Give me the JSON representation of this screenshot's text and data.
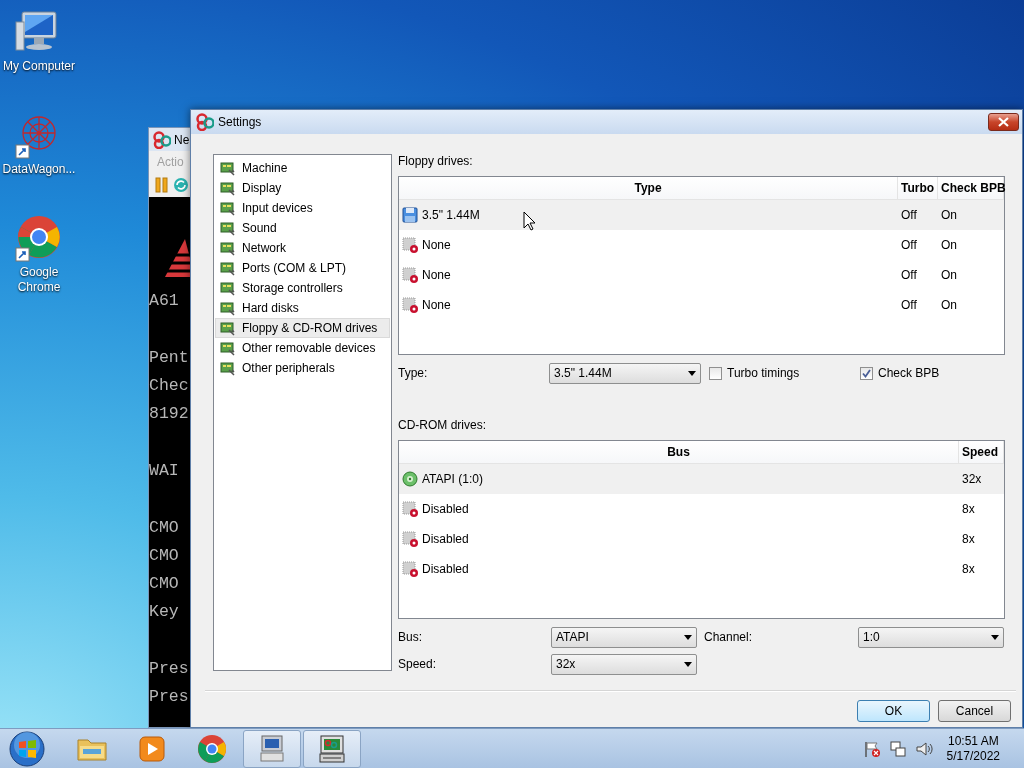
{
  "desktop_icons": [
    {
      "label": "My Computer",
      "kind": "computer"
    },
    {
      "label": "DataWagon...",
      "kind": "network"
    },
    {
      "label": "Google Chrome",
      "kind": "browser"
    }
  ],
  "background_window": {
    "title": "Ne",
    "menu": "Actio",
    "console_blocks": [
      [
        "A61"
      ],
      [
        "Pent",
        "Chec",
        "8192"
      ],
      [
        "WAI"
      ],
      [
        "CMO",
        "CMO",
        "CMO",
        "Key"
      ],
      [
        "Pres",
        "Pres"
      ]
    ]
  },
  "dialog": {
    "title": "Settings",
    "categories": [
      {
        "label": "Machine",
        "selected": false
      },
      {
        "label": "Display",
        "selected": false
      },
      {
        "label": "Input devices",
        "selected": false
      },
      {
        "label": "Sound",
        "selected": false
      },
      {
        "label": "Network",
        "selected": false
      },
      {
        "label": "Ports (COM & LPT)",
        "selected": false
      },
      {
        "label": "Storage controllers",
        "selected": false
      },
      {
        "label": "Hard disks",
        "selected": false
      },
      {
        "label": "Floppy & CD-ROM drives",
        "selected": true
      },
      {
        "label": "Other removable devices",
        "selected": false
      },
      {
        "label": "Other peripherals",
        "selected": false
      }
    ],
    "floppy": {
      "label": "Floppy drives:",
      "columns": [
        "Type",
        "Turbo",
        "Check BPB"
      ],
      "rows": [
        {
          "type": "3.5\" 1.44M",
          "turbo": "Off",
          "check_bpb": "On",
          "kind": "floppy",
          "selected": true
        },
        {
          "type": "None",
          "turbo": "Off",
          "check_bpb": "On",
          "kind": "empty",
          "selected": false
        },
        {
          "type": "None",
          "turbo": "Off",
          "check_bpb": "On",
          "kind": "empty",
          "selected": false
        },
        {
          "type": "None",
          "turbo": "Off",
          "check_bpb": "On",
          "kind": "empty",
          "selected": false
        }
      ],
      "type_label": "Type:",
      "type_value": "3.5\" 1.44M",
      "turbo_timings": {
        "label": "Turbo timings",
        "checked": false
      },
      "check_bpb": {
        "label": "Check BPB",
        "checked": true
      }
    },
    "cdrom": {
      "label": "CD-ROM drives:",
      "columns": [
        "Bus",
        "Speed"
      ],
      "rows": [
        {
          "bus": "ATAPI (1:0)",
          "speed": "32x",
          "kind": "cdrom",
          "selected": true
        },
        {
          "bus": "Disabled",
          "speed": "8x",
          "kind": "empty",
          "selected": false
        },
        {
          "bus": "Disabled",
          "speed": "8x",
          "kind": "empty",
          "selected": false
        },
        {
          "bus": "Disabled",
          "speed": "8x",
          "kind": "empty",
          "selected": false
        }
      ],
      "bus_label": "Bus:",
      "bus_value": "ATAPI",
      "channel_label": "Channel:",
      "channel_value": "1:0",
      "speed_label": "Speed:",
      "speed_value": "32x"
    },
    "buttons": [
      {
        "label": "OK",
        "default": true
      },
      {
        "label": "Cancel",
        "default": false
      }
    ]
  },
  "taskbar": {
    "items": [
      {
        "kind": "folder",
        "open": false
      },
      {
        "kind": "media",
        "open": false
      },
      {
        "kind": "browser",
        "open": false
      },
      {
        "kind": "vm",
        "open": true
      },
      {
        "kind": "emulator",
        "open": true
      }
    ],
    "time": "10:51 AM",
    "date": "5/17/2022"
  }
}
